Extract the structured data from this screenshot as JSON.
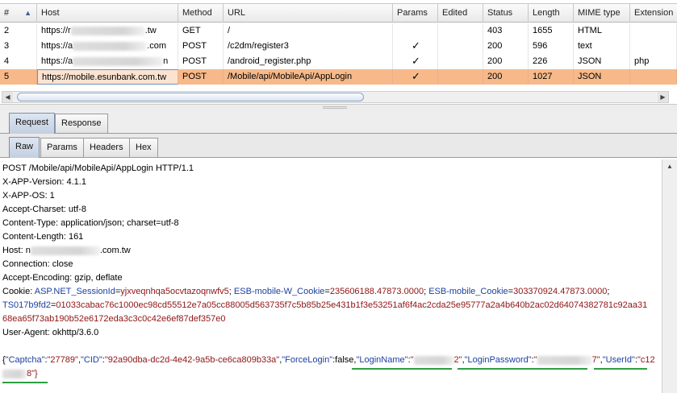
{
  "table": {
    "columns": [
      {
        "label": "#"
      },
      {
        "label": "Host"
      },
      {
        "label": "Method"
      },
      {
        "label": "URL"
      },
      {
        "label": "Params"
      },
      {
        "label": "Edited"
      },
      {
        "label": "Status"
      },
      {
        "label": "Length"
      },
      {
        "label": "MIME type"
      },
      {
        "label": "Extension"
      }
    ],
    "sort_indicator": "▲",
    "rows": [
      {
        "num": "2",
        "host_prefix": "https://r",
        "host_suffix": ".tw",
        "method": "GET",
        "url": "/",
        "params": "",
        "status": "403",
        "length": "1655",
        "mime": "HTML",
        "ext": ""
      },
      {
        "num": "3",
        "host_prefix": "https://a",
        "host_suffix": ".com",
        "method": "POST",
        "url": "/c2dm/register3",
        "params": "✓",
        "status": "200",
        "length": "596",
        "mime": "text",
        "ext": ""
      },
      {
        "num": "4",
        "host_prefix": "https://a",
        "host_suffix": "n",
        "method": "POST",
        "url": "/android_register.php",
        "params": "✓",
        "status": "200",
        "length": "226",
        "mime": "JSON",
        "ext": "php"
      },
      {
        "num": "5",
        "host_prefix": "https://mobile.esunbank.com.tw",
        "host_suffix": "",
        "method": "POST",
        "url": "/Mobile/api/MobileApi/AppLogin",
        "params": "✓",
        "status": "200",
        "length": "1027",
        "mime": "JSON",
        "ext": ""
      }
    ]
  },
  "outer_tabs": [
    "Request",
    "Response"
  ],
  "inner_tabs": [
    "Raw",
    "Params",
    "Headers",
    "Hex"
  ],
  "request": {
    "request_line": "POST /Mobile/api/MobileApi/AppLogin HTTP/1.1",
    "x_app_version": "X-APP-Version: 4.1.1",
    "x_app_os": "X-APP-OS: 1",
    "accept_charset": "Accept-Charset: utf-8",
    "content_type": "Content-Type: application/json; charset=utf-8",
    "content_length": "Content-Length: 161",
    "host_prefix": "Host: n",
    "host_suffix": ".com.tw",
    "connection": "Connection: close",
    "accept_encoding": "Accept-Encoding: gzip, deflate",
    "cookie_label": "Cookie: ",
    "cookie_1_name": "ASP.NET_SessionId",
    "cookie_1_value": "yjxveqnhqa5ocvtazoqnwfv5",
    "cookie_2_name": "ESB-mobile-W_Cookie",
    "cookie_2_value": "235606188.47873.0000",
    "cookie_3_name": "ESB-mobile_Cookie",
    "cookie_3_value": "303370924.47873.0000",
    "cookie_4_name": "TS017b9fd2",
    "cookie_4_value_part1": "01033cabac76c1000ec98cd55512e7a05cc88005d563735f7c5b85b25e431b1f3e53251af6f4ac2cda25e95777a2a4b640b2ac02d64074382781c92aa31",
    "cookie_4_value_part2": "68ea65f73ab190b52e6172eda3c3c0c42e6ef87def357e0",
    "user_agent": "User-Agent: okhttp/3.6.0",
    "body": {
      "captcha_key": "\"Captcha\"",
      "captcha_val": "\"27789\"",
      "cid_key": "\"CID\"",
      "cid_val": "\"92a90dba-dc2d-4e42-9a5b-ce6ca809b33a\"",
      "forcelogin_key": "\"ForceLogin\"",
      "forcelogin_val": "false",
      "loginname_key": "\"LoginName\"",
      "loginname_val_start": "\"",
      "loginname_val_end": "2\"",
      "loginpassword_key": "\"LoginPassword\"",
      "loginpassword_val_start": "\"",
      "loginpassword_val_end": "7\"",
      "userid_key": "\"UserId\"",
      "userid_val_start": "\"c12",
      "userid_val_end": "8\"}"
    }
  },
  "colors": {
    "selected_row": "#f7b98a",
    "cookie_name": "#1c3fa0",
    "cookie_value": "#8e1414",
    "underline": "#2e9e42"
  }
}
